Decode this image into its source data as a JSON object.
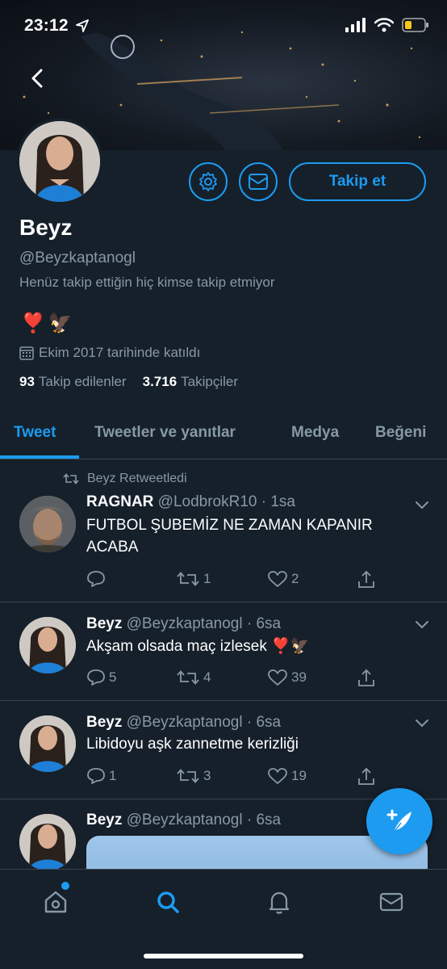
{
  "status_bar": {
    "time": "23:12"
  },
  "profile": {
    "follow_label": "Takip et",
    "name": "Beyz",
    "handle": "@Beyzkaptanogl",
    "followed_by_text": "Henüz takip ettiğin hiç kimse takip etmiyor",
    "bio_emoji": [
      "❣️",
      "🦅"
    ],
    "joined": "Ekim 2017 tarihinde katıldı",
    "following_count": "93",
    "following_label": "Takip edilenler",
    "followers_count": "3.716",
    "followers_label": "Takipçiler"
  },
  "tabs": [
    {
      "label": "Tweet",
      "active": true
    },
    {
      "label": "Tweetler ve yanıtlar",
      "active": false
    },
    {
      "label": "Medya",
      "active": false
    },
    {
      "label": "Beğeni",
      "active": false
    }
  ],
  "tweets": [
    {
      "retweet_label": "Beyz Retweetledi",
      "author": "RAGNAR",
      "handle_time": "@LodbrokR10 · 1sa",
      "text": "FUTBOL ŞUBEMİZ NE ZAMAN KAPANIR ACABA",
      "reply_count": "",
      "retweet_count": "1",
      "like_count": "2"
    },
    {
      "author": "Beyz",
      "handle_time": "@Beyzkaptanogl · 6sa",
      "text": "Akşam olsada maç izlesek ❣️🦅",
      "reply_count": "5",
      "retweet_count": "4",
      "like_count": "39"
    },
    {
      "author": "Beyz",
      "handle_time": "@Beyzkaptanogl · 6sa",
      "text": "Libidoyu aşk zannetme kerizliği",
      "reply_count": "1",
      "retweet_count": "3",
      "like_count": "19"
    },
    {
      "author": "Beyz",
      "handle_time": "@Beyzkaptanogl · 6sa"
    }
  ],
  "colors": {
    "accent": "#1d9bf0",
    "background": "#15202b",
    "muted": "#8899a6",
    "divider": "#38444d"
  }
}
